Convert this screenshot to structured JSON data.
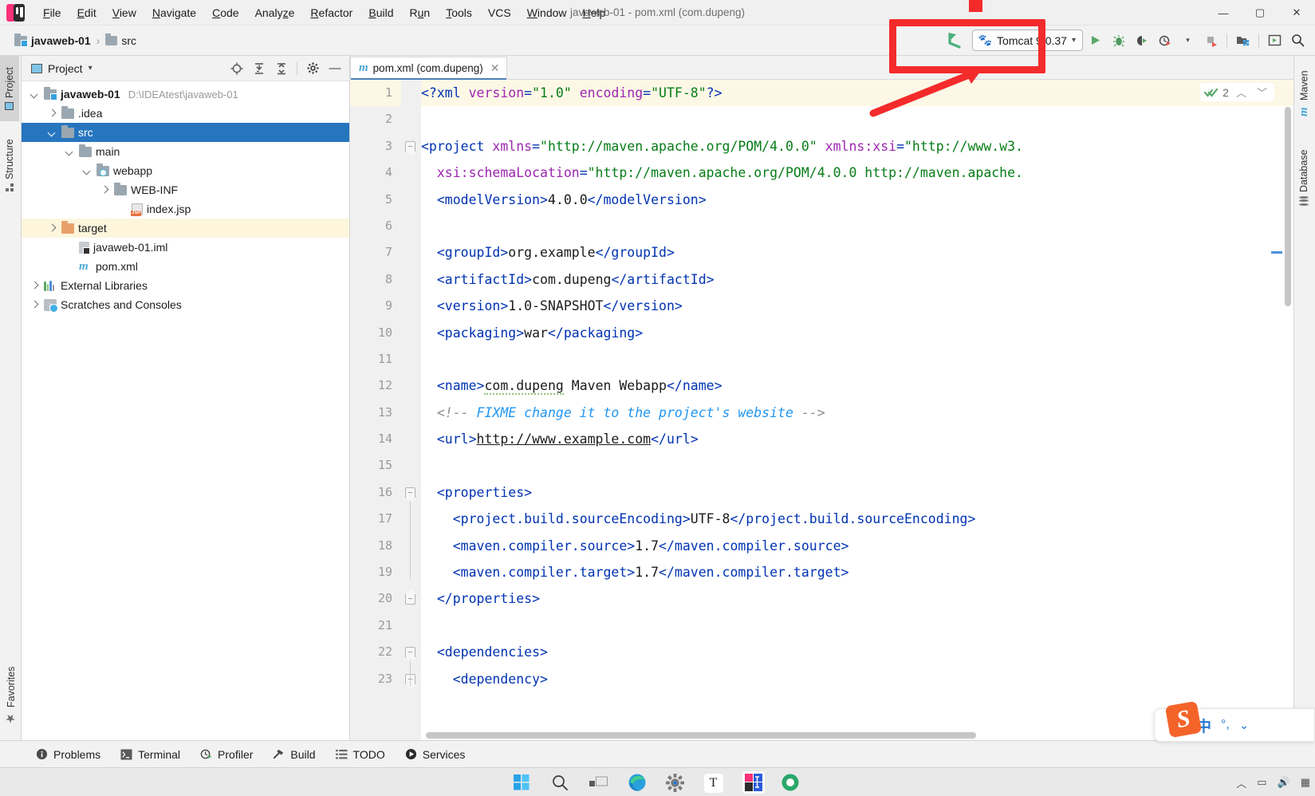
{
  "window": {
    "title": "javaweb-01 - pom.xml (com.dupeng)",
    "minimize": "—",
    "maximize": "▢",
    "close": "✕"
  },
  "menu": [
    {
      "label": "File"
    },
    {
      "label": "Edit"
    },
    {
      "label": "View"
    },
    {
      "label": "Navigate"
    },
    {
      "label": "Code"
    },
    {
      "label": "Analyze"
    },
    {
      "label": "Refactor"
    },
    {
      "label": "Build"
    },
    {
      "label": "Run"
    },
    {
      "label": "Tools"
    },
    {
      "label": "VCS"
    },
    {
      "label": "Window"
    },
    {
      "label": "Help"
    }
  ],
  "navbar": {
    "breadcrumb": [
      {
        "label": "javaweb-01",
        "icon": "module-icon"
      },
      {
        "label": "src",
        "icon": "folder-icon"
      }
    ],
    "separator": "›",
    "run_config": {
      "label": "Tomcat 9.0.37",
      "icon": "tomcat-icon",
      "dropdown": "▾"
    },
    "buttons": [
      {
        "name": "run-button",
        "icon": "play-icon"
      },
      {
        "name": "debug-button",
        "icon": "bug-icon"
      },
      {
        "name": "run-with-coverage-button",
        "icon": "coverage-icon"
      },
      {
        "name": "profile-button",
        "icon": "profiler-icon"
      },
      {
        "name": "stop-button",
        "icon": "stop-icon"
      },
      {
        "name": "update-application-button",
        "icon": "redeploy-icon"
      },
      {
        "name": "open-browser-button",
        "icon": "browser-icon"
      },
      {
        "name": "search-everywhere-button",
        "icon": "search-icon"
      }
    ]
  },
  "left_strip": [
    {
      "label": "Project",
      "icon": "project-icon",
      "selected": true
    },
    {
      "label": "Structure",
      "icon": "structure-icon",
      "selected": false
    }
  ],
  "left_strip_bottom": [
    {
      "label": "Favorites",
      "icon": "star-icon"
    }
  ],
  "right_strip": [
    {
      "label": "Maven",
      "icon": "maven-icon"
    },
    {
      "label": "Database",
      "icon": "database-icon"
    }
  ],
  "project_panel": {
    "title": "Project",
    "dropdown": "▾",
    "toolbar": [
      {
        "name": "select-opened-file-button",
        "icon": "target-icon"
      },
      {
        "name": "expand-all-button",
        "icon": "expand-all-icon"
      },
      {
        "name": "collapse-all-button",
        "icon": "collapse-all-icon"
      },
      {
        "name": "settings-button",
        "icon": "gear-icon"
      },
      {
        "name": "hide-button",
        "icon": "minimize-icon"
      }
    ],
    "tree": [
      {
        "label": "javaweb-01",
        "path": "D:\\IDEAtest\\javaweb-01",
        "depth": 0,
        "icon": "module-icon",
        "arrow": "open",
        "bold": true,
        "state": ""
      },
      {
        "label": ".idea",
        "path": "",
        "depth": 1,
        "icon": "folder-icon",
        "arrow": "closed",
        "bold": false,
        "state": ""
      },
      {
        "label": "src",
        "path": "",
        "depth": 1,
        "icon": "folder-icon",
        "arrow": "open",
        "bold": false,
        "state": "selected"
      },
      {
        "label": "main",
        "path": "",
        "depth": 2,
        "icon": "folder-icon",
        "arrow": "open",
        "bold": false,
        "state": ""
      },
      {
        "label": "webapp",
        "path": "",
        "depth": 3,
        "icon": "webapp-icon",
        "arrow": "open",
        "bold": false,
        "state": ""
      },
      {
        "label": "WEB-INF",
        "path": "",
        "depth": 4,
        "icon": "folder-icon",
        "arrow": "closed",
        "bold": false,
        "state": ""
      },
      {
        "label": "index.jsp",
        "path": "",
        "depth": 5,
        "icon": "jsp-file-icon",
        "arrow": "none",
        "bold": false,
        "state": ""
      },
      {
        "label": "target",
        "path": "",
        "depth": 1,
        "icon": "folder-orange-icon",
        "arrow": "closed",
        "bold": false,
        "state": "highlight"
      },
      {
        "label": "javaweb-01.iml",
        "path": "",
        "depth": 2,
        "icon": "iml-file-icon",
        "arrow": "none",
        "bold": false,
        "state": ""
      },
      {
        "label": "pom.xml",
        "path": "",
        "depth": 2,
        "icon": "maven-file-icon",
        "arrow": "none",
        "bold": false,
        "state": ""
      },
      {
        "label": "External Libraries",
        "path": "",
        "depth": 0,
        "icon": "libraries-icon",
        "arrow": "closed",
        "bold": false,
        "state": ""
      },
      {
        "label": "Scratches and Consoles",
        "path": "",
        "depth": 0,
        "icon": "scratches-icon",
        "arrow": "closed",
        "bold": false,
        "state": ""
      }
    ]
  },
  "editor": {
    "tab": {
      "label": "pom.xml (com.dupeng)",
      "icon": "maven-file-icon",
      "close": "✕"
    },
    "inspection": {
      "icon": "inspection-ok-icon",
      "count": "2",
      "up": "︿",
      "down": "﹀"
    },
    "lines": [
      {
        "n": "1",
        "current": true,
        "fold": "",
        "html": "<span class=\"tg\">&lt;?xml</span> <span class=\"at\">version</span><span class=\"tg\">=</span><span class=\"st\">\"1.0\"</span> <span class=\"at\">encoding</span><span class=\"tg\">=</span><span class=\"st\">\"UTF-8\"</span><span class=\"tg\">?&gt;</span>"
      },
      {
        "n": "2",
        "current": false,
        "fold": "",
        "html": ""
      },
      {
        "n": "3",
        "current": false,
        "fold": "top",
        "html": "<span class=\"tg\">&lt;project</span> <span class=\"at\">xmlns</span><span class=\"tg\">=</span><span class=\"st\">\"http://maven.apache.org/POM/4.0.0\"</span> <span class=\"at\">xmlns:xsi</span><span class=\"tg\">=</span><span class=\"st\">\"http://www.w3.</span>"
      },
      {
        "n": "4",
        "current": false,
        "fold": "",
        "html": "  <span class=\"at\">xsi:schemaLocation</span><span class=\"tg\">=</span><span class=\"st\">\"http://maven.apache.org/POM/4.0.0 http://maven.apache.</span>"
      },
      {
        "n": "5",
        "current": false,
        "fold": "",
        "html": "  <span class=\"tg\">&lt;modelVersion&gt;</span><span class=\"tx\">4.0.0</span><span class=\"tg\">&lt;/modelVersion&gt;</span>"
      },
      {
        "n": "6",
        "current": false,
        "fold": "",
        "html": ""
      },
      {
        "n": "7",
        "current": false,
        "fold": "",
        "html": "  <span class=\"tg\">&lt;groupId&gt;</span><span class=\"tx\">org.example</span><span class=\"tg\">&lt;/groupId&gt;</span>"
      },
      {
        "n": "8",
        "current": false,
        "fold": "",
        "html": "  <span class=\"tg\">&lt;artifactId&gt;</span><span class=\"tx\">com.dupeng</span><span class=\"tg\">&lt;/artifactId&gt;</span>"
      },
      {
        "n": "9",
        "current": false,
        "fold": "",
        "html": "  <span class=\"tg\">&lt;version&gt;</span><span class=\"tx\">1.0-SNAPSHOT</span><span class=\"tg\">&lt;/version&gt;</span>"
      },
      {
        "n": "10",
        "current": false,
        "fold": "",
        "html": "  <span class=\"tg\">&lt;packaging&gt;</span><span class=\"tx\">war</span><span class=\"tg\">&lt;/packaging&gt;</span>"
      },
      {
        "n": "11",
        "current": false,
        "fold": "",
        "html": ""
      },
      {
        "n": "12",
        "current": false,
        "fold": "",
        "html": "  <span class=\"tg\">&lt;name&gt;</span><span class=\"tx warnsq\">com.dupeng</span><span class=\"tx\"> Maven Webapp</span><span class=\"tg\">&lt;/name&gt;</span>"
      },
      {
        "n": "13",
        "current": false,
        "fold": "",
        "html": "  <span class=\"cm\">&lt;!-- </span><span class=\"cmk\">FIXME change it to the project's website</span><span class=\"cm\"> --&gt;</span>"
      },
      {
        "n": "14",
        "current": false,
        "fold": "",
        "html": "  <span class=\"tg\">&lt;url&gt;</span><span class=\"lnk\">http://www.example.com</span><span class=\"tg\">&lt;/url&gt;</span>"
      },
      {
        "n": "15",
        "current": false,
        "fold": "",
        "html": ""
      },
      {
        "n": "16",
        "current": false,
        "fold": "top",
        "html": "  <span class=\"tg\">&lt;properties&gt;</span>"
      },
      {
        "n": "17",
        "current": false,
        "fold": "",
        "html": "    <span class=\"tg\">&lt;project.build.sourceEncoding&gt;</span><span class=\"tx\">UTF-8</span><span class=\"tg\">&lt;/project.build.sourceEncoding&gt;</span>"
      },
      {
        "n": "18",
        "current": false,
        "fold": "",
        "html": "    <span class=\"tg\">&lt;maven.compiler.source&gt;</span><span class=\"tx\">1.7</span><span class=\"tg\">&lt;/maven.compiler.source&gt;</span>"
      },
      {
        "n": "19",
        "current": false,
        "fold": "",
        "html": "    <span class=\"tg\">&lt;maven.compiler.target&gt;</span><span class=\"tx\">1.7</span><span class=\"tg\">&lt;/maven.compiler.target&gt;</span>"
      },
      {
        "n": "20",
        "current": false,
        "fold": "end",
        "html": "  <span class=\"tg\">&lt;/properties&gt;</span>"
      },
      {
        "n": "21",
        "current": false,
        "fold": "",
        "html": ""
      },
      {
        "n": "22",
        "current": false,
        "fold": "top",
        "html": "  <span class=\"tg\">&lt;dependencies&gt;</span>"
      },
      {
        "n": "23",
        "current": false,
        "fold": "top",
        "html": "    <span class=\"tg\">&lt;dependency&gt;</span>"
      }
    ]
  },
  "statusbar": [
    {
      "label": "Problems",
      "icon": "problems-icon"
    },
    {
      "label": "Terminal",
      "icon": "terminal-icon"
    },
    {
      "label": "Profiler",
      "icon": "profiler-icon"
    },
    {
      "label": "Build",
      "icon": "hammer-icon"
    },
    {
      "label": "TODO",
      "icon": "todo-icon"
    },
    {
      "label": "Services",
      "icon": "services-icon"
    }
  ],
  "taskbar": [
    {
      "name": "start-button",
      "icon": "windows-icon"
    },
    {
      "name": "search-button",
      "icon": "search-icon"
    },
    {
      "name": "task-view-button",
      "icon": "task-view-icon"
    },
    {
      "name": "edge-button",
      "icon": "edge-icon"
    },
    {
      "name": "settings-button",
      "icon": "settings-gear-icon"
    },
    {
      "name": "text-app-button",
      "icon": "text-icon"
    },
    {
      "name": "intellij-button",
      "icon": "intellij-icon"
    },
    {
      "name": "other-app-button",
      "icon": "app-icon"
    }
  ],
  "ime": {
    "mode": "中",
    "punct": "°,",
    "icon": "sogou-icon",
    "logo_letter": "S"
  },
  "colors": {
    "accent": "#2675bf",
    "annotation": "#f42b2b",
    "arrow_green": "#4caf7d",
    "tag": "#0033b3",
    "string": "#067d17",
    "attribute": "#9c27b0"
  }
}
